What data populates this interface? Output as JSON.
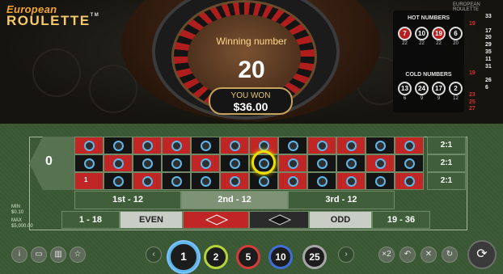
{
  "logo": {
    "line1": "European",
    "line2": "ROULETTE",
    "tm": "TM"
  },
  "mini_title": "EUROPEAN ROULETTE",
  "result": {
    "label": "Winning number",
    "number": "20",
    "won_label": "YOU WON",
    "won_amount": "$36.00"
  },
  "hot_numbers": {
    "title": "HOT NUMBERS",
    "items": [
      {
        "number": "7",
        "count": "22",
        "color": "red"
      },
      {
        "number": "10",
        "count": "22",
        "color": "black"
      },
      {
        "number": "19",
        "count": "22",
        "color": "red"
      },
      {
        "number": "6",
        "count": "20",
        "color": "black"
      }
    ]
  },
  "cold_numbers": {
    "title": "COLD NUMBERS",
    "items": [
      {
        "number": "13",
        "count": "6",
        "color": "black"
      },
      {
        "number": "24",
        "count": "9",
        "color": "black"
      },
      {
        "number": "17",
        "count": "9",
        "color": "black"
      },
      {
        "number": "2",
        "count": "12",
        "color": "black"
      }
    ]
  },
  "history": [
    {
      "value": "33",
      "color": "white"
    },
    {
      "value": "19",
      "color": "red"
    },
    {
      "value": "17",
      "color": "white"
    },
    {
      "value": "20",
      "color": "white"
    },
    {
      "value": "29",
      "color": "white"
    },
    {
      "value": "35",
      "color": "white"
    },
    {
      "value": "11",
      "color": "white"
    },
    {
      "value": "31",
      "color": "white"
    },
    {
      "value": "19",
      "color": "red"
    },
    {
      "value": "26",
      "color": "white"
    },
    {
      "value": "6",
      "color": "white"
    },
    {
      "value": "23",
      "color": "red"
    },
    {
      "value": "25",
      "color": "red"
    },
    {
      "value": "27",
      "color": "red"
    }
  ],
  "table": {
    "zero": "0",
    "rows": [
      [
        "red",
        "black",
        "red",
        "red",
        "black",
        "red",
        "red",
        "black",
        "red",
        "red",
        "black",
        "red"
      ],
      [
        "black",
        "red",
        "black",
        "black",
        "red",
        "black",
        "black",
        "red",
        "black",
        "black",
        "red",
        "black"
      ],
      [
        "red",
        "black",
        "red",
        "black",
        "black",
        "red",
        "black",
        "red",
        "black",
        "red",
        "black",
        "red"
      ]
    ],
    "first_cell_label": "1",
    "column_labels": [
      "2:1",
      "2:1",
      "2:1"
    ],
    "dozens": [
      "1st - 12",
      "2nd - 12",
      "3rd - 12"
    ],
    "outside": {
      "low": "1 - 18",
      "even": "EVEN",
      "odd": "ODD",
      "high": "19 - 36"
    }
  },
  "limits": {
    "min_label": "MIN",
    "min_value": "$0.10",
    "max_label": "MAX",
    "max_value": "$5,000.00"
  },
  "chips": [
    {
      "value": "1",
      "color": "#5fb6e8",
      "selected": true
    },
    {
      "value": "2",
      "color": "#b5d33a"
    },
    {
      "value": "5",
      "color": "#d43c3c"
    },
    {
      "value": "10",
      "color": "#3f6fd6"
    },
    {
      "value": "25",
      "color": "#a6a6a6"
    }
  ],
  "left_icons": [
    "info-icon",
    "chat-icon",
    "stats-icon",
    "favorite-icon"
  ],
  "right_icons": [
    {
      "name": "double-icon",
      "glyph": "×2"
    },
    {
      "name": "undo-icon",
      "glyph": "↶"
    },
    {
      "name": "clear-icon",
      "glyph": "✕"
    },
    {
      "name": "rebet-icon",
      "glyph": "↻"
    }
  ],
  "colors": {
    "felt": "#3c5b36",
    "red": "#c12626",
    "black": "#141414",
    "highlight": "#f0e000"
  }
}
